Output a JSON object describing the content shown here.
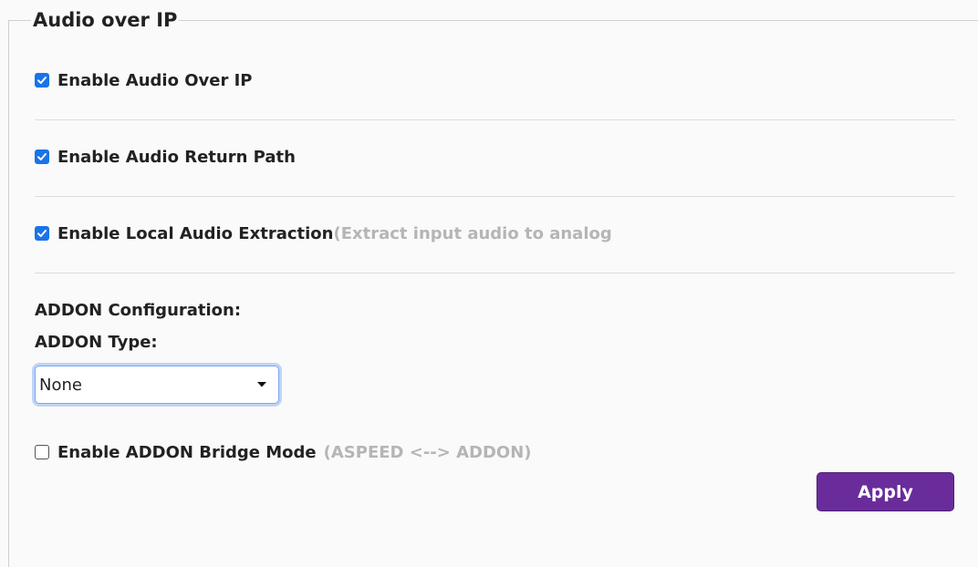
{
  "section": {
    "title": "Audio over IP"
  },
  "options": {
    "enable_aoip": {
      "label": "Enable Audio Over IP",
      "checked": true
    },
    "enable_return_path": {
      "label": "Enable Audio Return Path",
      "checked": true
    },
    "enable_local_extraction": {
      "label": "Enable Local Audio Extraction",
      "hint": "(Extract input audio to analog",
      "checked": true
    }
  },
  "addon": {
    "config_heading": "ADDON Configuration:",
    "type_label": "ADDON Type:",
    "type_selected": "None",
    "bridge_mode": {
      "label": "Enable ADDON Bridge Mode",
      "hint": "(ASPEED <--> ADDON)",
      "checked": false
    }
  },
  "actions": {
    "apply_label": "Apply"
  },
  "colors": {
    "checkbox_checked": "#1a73e8",
    "apply_button": "#6a2c9a",
    "hint_text": "#b5b5b5",
    "select_focus": "#7aa7f0"
  },
  "icons": {
    "check": "checkmark-icon",
    "dropdown": "caret-down-icon"
  }
}
